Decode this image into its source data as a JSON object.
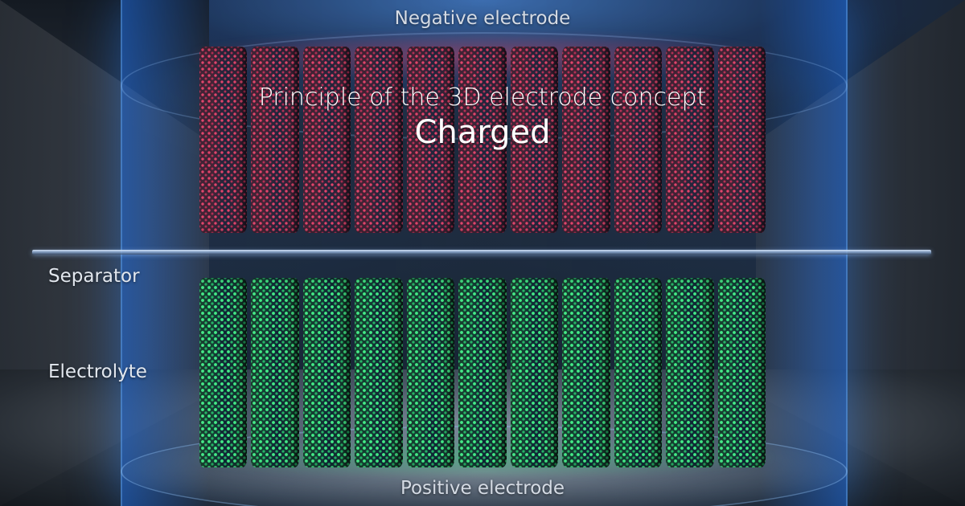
{
  "labels": {
    "negative_electrode": "Negative electrode",
    "title": "Principle of the 3D electrode concept",
    "state": "Charged",
    "separator": "Separator",
    "electrolyte": "Electrolyte",
    "positive_electrode": "Positive electrode"
  },
  "negative_pillars": 11,
  "positive_pillars": 11,
  "colors": {
    "negative_electrode": "#e5466e",
    "positive_electrode": "#46f58c",
    "glass_glow": "#2a82ff",
    "separator": "#dce8ff"
  }
}
